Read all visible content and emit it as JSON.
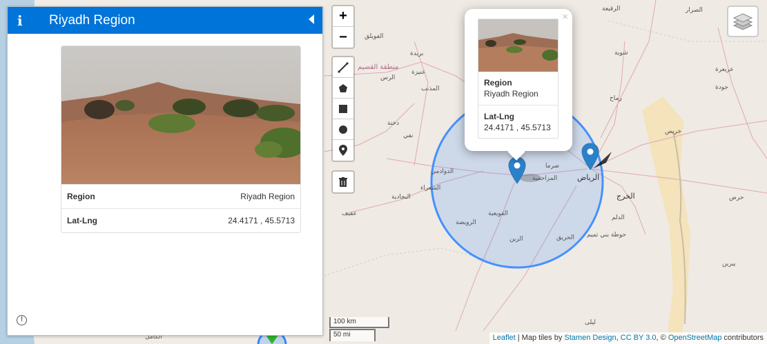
{
  "sidebar": {
    "info_glyph": "i",
    "title": "Riyadh Region",
    "rows": [
      {
        "key": "Region",
        "value": "Riyadh Region"
      },
      {
        "key": "Lat-Lng",
        "value": "24.4171 , 45.5713"
      }
    ],
    "alert_glyph": "!"
  },
  "zoom": {
    "in": "+",
    "out": "−"
  },
  "popup": {
    "close": "×",
    "region_label": "Region",
    "region_value": "Riyadh Region",
    "latlng_label": "Lat-Lng",
    "latlng_value": "24.4171 , 45.5713"
  },
  "scale": {
    "km": "100 km",
    "mi": "50 mi"
  },
  "attribution": {
    "leaflet": "Leaflet",
    "sep1": " | Map tiles by ",
    "stamen": "Stamen Design",
    "sep2": ", ",
    "license": "CC BY 3.0",
    "sep3": ", © ",
    "osm": "OpenStreetMap",
    "tail": " contributors"
  },
  "places": [
    {
      "name": "الرياض",
      "kind": "city"
    },
    {
      "name": "الخرج",
      "kind": "city"
    },
    {
      "name": "منطقة القصيم",
      "kind": "region"
    },
    {
      "name": "بريدة",
      "kind": "town"
    },
    {
      "name": "عنيزة",
      "kind": "town"
    },
    {
      "name": "الرس",
      "kind": "town"
    },
    {
      "name": "المذنب",
      "kind": "town"
    },
    {
      "name": "الفويلق",
      "kind": "town"
    },
    {
      "name": "الدوادمي",
      "kind": "town"
    },
    {
      "name": "الشعراء",
      "kind": "town"
    },
    {
      "name": "البجادية",
      "kind": "town"
    },
    {
      "name": "عفيف",
      "kind": "town"
    },
    {
      "name": "الرويضة",
      "kind": "town"
    },
    {
      "name": "القويعية",
      "kind": "town"
    },
    {
      "name": "الرين",
      "kind": "town"
    },
    {
      "name": "الحريق",
      "kind": "town"
    },
    {
      "name": "المزاحمية",
      "kind": "town"
    },
    {
      "name": "ضرما",
      "kind": "town"
    },
    {
      "name": "الدلم",
      "kind": "town"
    },
    {
      "name": "حوطة بني تميم",
      "kind": "town"
    },
    {
      "name": "خريص",
      "kind": "town"
    },
    {
      "name": "رماح",
      "kind": "town"
    },
    {
      "name": "شوية",
      "kind": "town"
    },
    {
      "name": "عريعرة",
      "kind": "town"
    },
    {
      "name": "جودة",
      "kind": "town"
    },
    {
      "name": "الرقيعة",
      "kind": "town"
    },
    {
      "name": "الصرار",
      "kind": "town"
    },
    {
      "name": "حرض",
      "kind": "town"
    },
    {
      "name": "يبرين",
      "kind": "town"
    },
    {
      "name": "ليلى",
      "kind": "town"
    },
    {
      "name": "نفي",
      "kind": "town"
    },
    {
      "name": "دخنة",
      "kind": "town"
    },
    {
      "name": "الكامل",
      "kind": "town"
    }
  ]
}
